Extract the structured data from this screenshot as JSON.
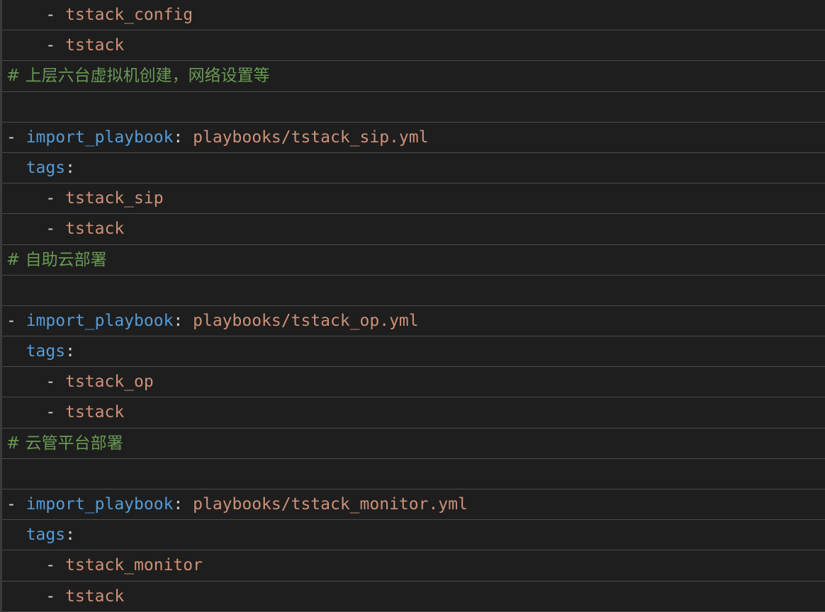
{
  "lines": [
    {
      "indent": "    ",
      "parts": [
        {
          "t": "- ",
          "c": "dash"
        },
        {
          "t": "tstack_config",
          "c": "text"
        }
      ]
    },
    {
      "indent": "    ",
      "parts": [
        {
          "t": "- ",
          "c": "dash"
        },
        {
          "t": "tstack",
          "c": "text"
        }
      ]
    },
    {
      "indent": "",
      "parts": [
        {
          "t": "# 上层六台虚拟机创建，网络设置等",
          "c": "comment"
        }
      ]
    },
    {
      "indent": "",
      "parts": []
    },
    {
      "indent": "",
      "parts": [
        {
          "t": "- ",
          "c": "dash"
        },
        {
          "t": "import_playbook",
          "c": "key"
        },
        {
          "t": ": ",
          "c": "colon"
        },
        {
          "t": "playbooks/tstack_sip.yml",
          "c": "text"
        }
      ]
    },
    {
      "indent": "  ",
      "parts": [
        {
          "t": "tags",
          "c": "key"
        },
        {
          "t": ":",
          "c": "colon"
        }
      ]
    },
    {
      "indent": "    ",
      "parts": [
        {
          "t": "- ",
          "c": "dash"
        },
        {
          "t": "tstack_sip",
          "c": "text"
        }
      ]
    },
    {
      "indent": "    ",
      "parts": [
        {
          "t": "- ",
          "c": "dash"
        },
        {
          "t": "tstack",
          "c": "text"
        }
      ]
    },
    {
      "indent": "",
      "parts": [
        {
          "t": "# 自助云部署",
          "c": "comment"
        }
      ]
    },
    {
      "indent": "",
      "parts": []
    },
    {
      "indent": "",
      "parts": [
        {
          "t": "- ",
          "c": "dash"
        },
        {
          "t": "import_playbook",
          "c": "key"
        },
        {
          "t": ": ",
          "c": "colon"
        },
        {
          "t": "playbooks/tstack_op.yml",
          "c": "text"
        }
      ]
    },
    {
      "indent": "  ",
      "parts": [
        {
          "t": "tags",
          "c": "key"
        },
        {
          "t": ":",
          "c": "colon"
        }
      ]
    },
    {
      "indent": "    ",
      "parts": [
        {
          "t": "- ",
          "c": "dash"
        },
        {
          "t": "tstack_op",
          "c": "text"
        }
      ]
    },
    {
      "indent": "    ",
      "parts": [
        {
          "t": "- ",
          "c": "dash"
        },
        {
          "t": "tstack",
          "c": "text"
        }
      ]
    },
    {
      "indent": "",
      "parts": [
        {
          "t": "# 云管平台部署",
          "c": "comment"
        }
      ]
    },
    {
      "indent": "",
      "parts": []
    },
    {
      "indent": "",
      "parts": [
        {
          "t": "- ",
          "c": "dash"
        },
        {
          "t": "import_playbook",
          "c": "key"
        },
        {
          "t": ": ",
          "c": "colon"
        },
        {
          "t": "playbooks/tstack_monitor.yml",
          "c": "text"
        }
      ]
    },
    {
      "indent": "  ",
      "parts": [
        {
          "t": "tags",
          "c": "key"
        },
        {
          "t": ":",
          "c": "colon"
        }
      ]
    },
    {
      "indent": "    ",
      "parts": [
        {
          "t": "- ",
          "c": "dash"
        },
        {
          "t": "tstack_monitor",
          "c": "text"
        }
      ]
    },
    {
      "indent": "    ",
      "parts": [
        {
          "t": "- ",
          "c": "dash"
        },
        {
          "t": "tstack",
          "c": "text"
        }
      ]
    }
  ],
  "colors": {
    "background": "#1e1e1e",
    "string": "#ce9178",
    "key": "#569cd6",
    "comment": "#6a9955",
    "punctuation": "#d4d4d4",
    "row_border": "#4a4a4a"
  }
}
